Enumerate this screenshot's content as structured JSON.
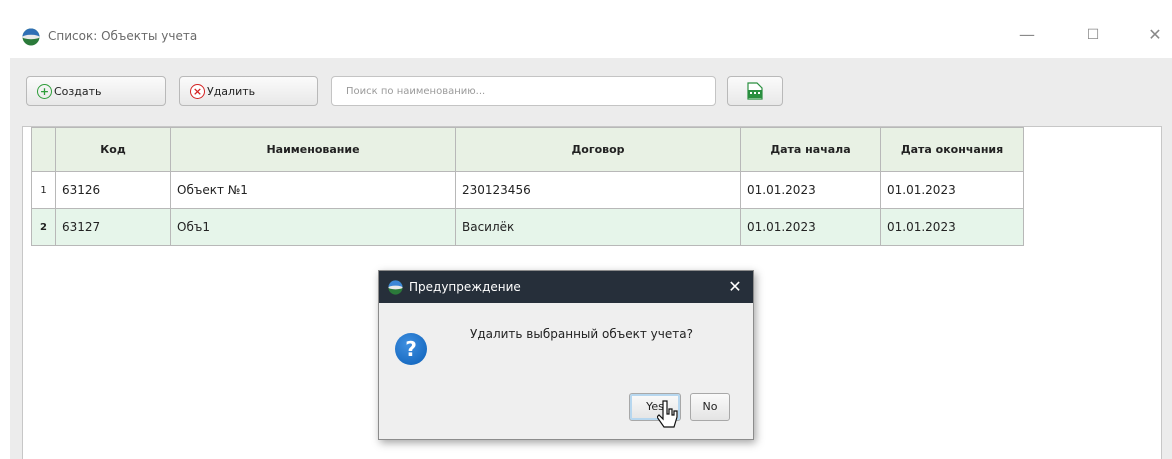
{
  "window": {
    "title": "Список: Объекты учета",
    "controls": {
      "minimize": "—",
      "maximize": "☐",
      "close": "✕"
    }
  },
  "toolbar": {
    "create_label": "Создать",
    "delete_label": "Удалить",
    "search_placeholder": "Поиск по наименованию...",
    "search_value": "",
    "export_icon": "xls-export-icon"
  },
  "table": {
    "headers": [
      "",
      "Код",
      "Наименование",
      "Договор",
      "Дата начала",
      "Дата окончания"
    ],
    "rows": [
      {
        "num": "1",
        "code": "63126",
        "name": "Объект №1",
        "contract": "230123456",
        "start": "01.01.2023",
        "end": "01.01.2023"
      },
      {
        "num": "2",
        "code": "63127",
        "name": "Объ1",
        "contract": "Василёк",
        "start": "01.01.2023",
        "end": "01.01.2023"
      }
    ]
  },
  "dialog": {
    "title": "Предупреждение",
    "message": "Удалить выбранный объект учета?",
    "icon": "question-icon",
    "yes_label": "Yes",
    "no_label": "No",
    "close": "✕"
  },
  "colors": {
    "header_bg": "#e8f1e4",
    "selected_row_bg": "#e6f5ea",
    "dialog_title_bg": "#262f3a",
    "question_icon": "#1a6fc8",
    "create_accent": "#2e9d3a",
    "delete_accent": "#d32222"
  }
}
